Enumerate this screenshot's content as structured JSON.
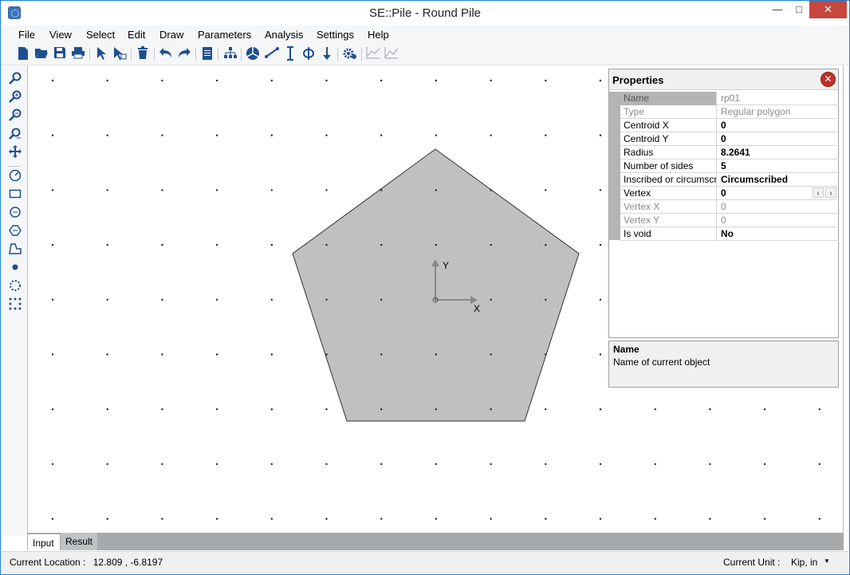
{
  "window": {
    "title": "SE::Pile - Round Pile",
    "minimize": "—",
    "maximize": "□",
    "close": "✕"
  },
  "menu": [
    "File",
    "View",
    "Select",
    "Edit",
    "Draw",
    "Parameters",
    "Analysis",
    "Settings",
    "Help"
  ],
  "toolbar": {
    "icons": [
      "new-file-icon",
      "open-folder-icon",
      "save-icon",
      "print-icon",
      "select-pointer-icon",
      "select-object-icon",
      "delete-icon",
      "undo-icon",
      "redo-icon",
      "report-icon",
      "hierarchy-icon",
      "pie-chart-icon",
      "line-icon",
      "dimension-icon",
      "diameter-icon",
      "load-arrow-icon",
      "settings-gear-icon",
      "chart-disabled-icon",
      "chart-line-disabled-icon"
    ]
  },
  "left_tools": {
    "icons": [
      "zoom-tool-icon",
      "zoom-in-icon",
      "zoom-out-icon",
      "zoom-extent-icon",
      "pan-icon",
      "measure-icon",
      "rectangle-icon",
      "circle-icon",
      "polygon-icon",
      "custom-shape-icon",
      "point-icon",
      "circle-pattern-icon",
      "grid-pattern-icon"
    ]
  },
  "drawing": {
    "axis_x_label": "X",
    "axis_y_label": "Y",
    "shape_fill": "#c0c0c0"
  },
  "properties": {
    "title": "Properties",
    "rows": [
      {
        "name": "Name",
        "value": "rp01"
      },
      {
        "name": "Type",
        "value": "Regular polygon"
      },
      {
        "name": "Centroid  X",
        "value": "0"
      },
      {
        "name": "Centroid  Y",
        "value": "0"
      },
      {
        "name": "Radius",
        "value": "8.2641"
      },
      {
        "name": "Number of sides",
        "value": "5"
      },
      {
        "name": "Inscribed or circumscribed",
        "value": "Circumscribed"
      },
      {
        "name": "Vertex",
        "value": "0"
      },
      {
        "name": "Vertex X",
        "value": "0"
      },
      {
        "name": "Vertex Y",
        "value": "0"
      },
      {
        "name": "Is void",
        "value": "No"
      }
    ],
    "spin_prev": "‹",
    "spin_next": "›"
  },
  "description": {
    "title": "Name",
    "text": "Name of current object"
  },
  "tabs": {
    "input": "Input",
    "result": "Result"
  },
  "status": {
    "location_label": "Current Location :",
    "location_value": "12.809 , -6.8197",
    "unit_label": "Current Unit :",
    "unit_value": "Kip, in"
  }
}
